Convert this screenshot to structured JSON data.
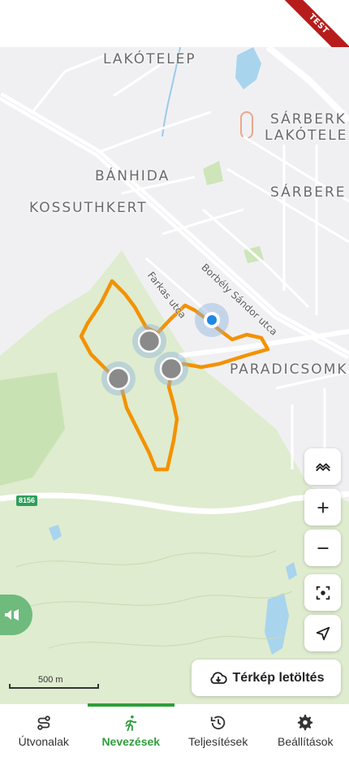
{
  "badge": {
    "test": "TEST"
  },
  "map": {
    "places": {
      "lakotelep": "LAKÓTELEP",
      "sarberek_1": "SÁRBERK",
      "sarberek_2": "LAKÓTELE",
      "banhida": "BÁNHIDA",
      "kossuthkert": "KOSSUTHKERT",
      "sarbereg": "SÁRBERE",
      "paradicsom": "PARADICSOMK"
    },
    "streets": {
      "borbely": "Borbély Sándor utca",
      "farkas": "Farkas utca"
    },
    "road_number": "8156",
    "scale_text": "500 m",
    "route_color": "#f39200",
    "location_color": "#1e88e5"
  },
  "controls": {
    "layers_icon": "layers-icon",
    "zoom_in_icon": "plus-icon",
    "zoom_out_icon": "minus-icon",
    "focus_icon": "focus-icon",
    "locate_icon": "navigation-arrow-icon",
    "announce_icon": "megaphone-icon",
    "download_label": "Térkép letöltés"
  },
  "nav": {
    "items": [
      {
        "label": "Útvonalak",
        "icon": "route-icon",
        "active": false
      },
      {
        "label": "Nevezések",
        "icon": "runner-icon",
        "active": true
      },
      {
        "label": "Teljesítések",
        "icon": "history-icon",
        "active": false
      },
      {
        "label": "Beállítások",
        "icon": "gear-icon",
        "active": false
      }
    ],
    "accent": "#2e9e3b"
  }
}
